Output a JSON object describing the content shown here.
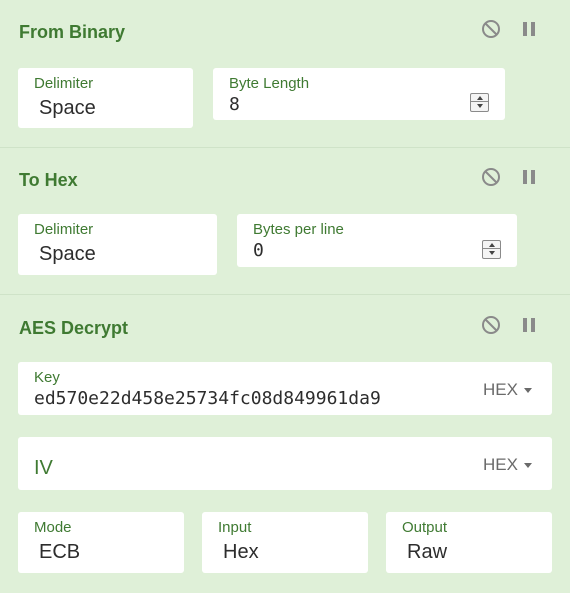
{
  "operations": {
    "from_binary": {
      "title": "From Binary",
      "delimiter_label": "Delimiter",
      "delimiter_value": "Space",
      "byte_length_label": "Byte Length",
      "byte_length_value": "8"
    },
    "to_hex": {
      "title": "To Hex",
      "delimiter_label": "Delimiter",
      "delimiter_value": "Space",
      "bytes_per_line_label": "Bytes per line",
      "bytes_per_line_value": "0"
    },
    "aes_decrypt": {
      "title": "AES Decrypt",
      "key_label": "Key",
      "key_value": "ed570e22d458e25734fc08d849961da9",
      "key_encoding": "HEX",
      "iv_label": "IV",
      "iv_encoding": "HEX",
      "mode_label": "Mode",
      "mode_value": "ECB",
      "input_label": "Input",
      "input_value": "Hex",
      "output_label": "Output",
      "output_value": "Raw"
    }
  },
  "icons": {
    "disable": "disable-icon",
    "pause": "pause-icon"
  },
  "colors": {
    "background": "#dff0d8",
    "title": "#3f7a32",
    "icon": "#8a8a8a"
  }
}
